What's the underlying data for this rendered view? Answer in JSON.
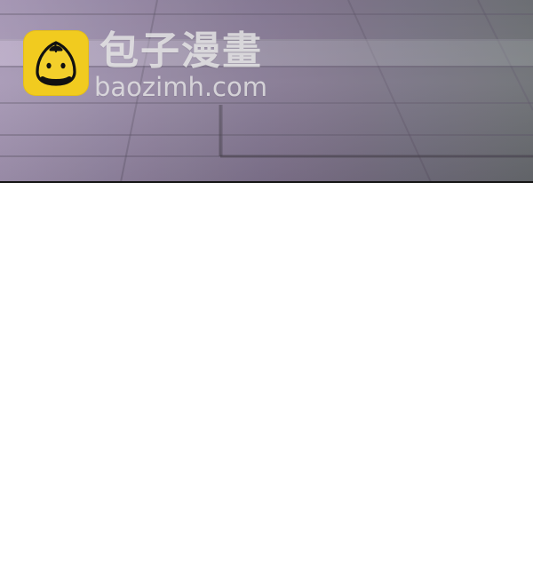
{
  "watermark": {
    "brand_cn": "包子漫畫",
    "domain": "baozimh.com",
    "logo_icon": "steamed-bun-icon",
    "logo_color": "#f1cb1f"
  },
  "scene": {
    "panel_style": "dark purple gray tiled floor"
  }
}
